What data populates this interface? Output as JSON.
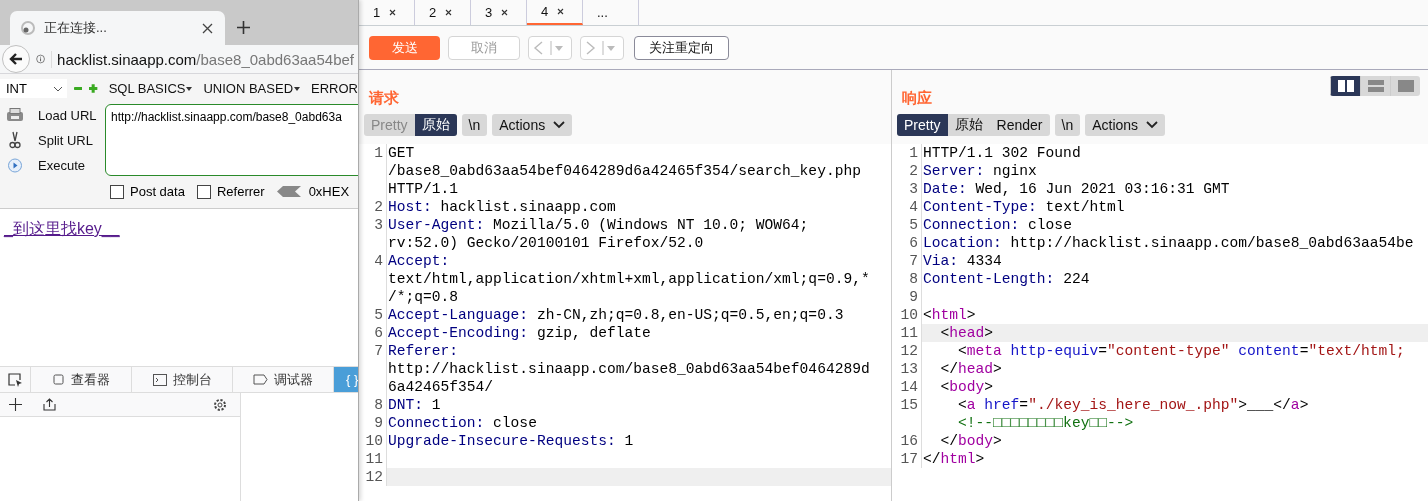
{
  "browser": {
    "tab": {
      "title": "正在连接..."
    },
    "address": {
      "host": "hacklist.sinaapp.com",
      "path": "/base8_0abd63aa54bef"
    },
    "hackbar": {
      "encoding": "INT",
      "menus": [
        {
          "label": "SQL BASICS",
          "dropdown": true
        },
        {
          "label": "UNION BASED",
          "dropdown": true
        },
        {
          "label": "ERROR",
          "dropdown": false
        }
      ],
      "actions": [
        {
          "label": "Load URL",
          "kind": "load"
        },
        {
          "label": "Split URL",
          "kind": "split"
        },
        {
          "label": "Execute",
          "kind": "execute"
        }
      ],
      "url": "http://hacklist.sinaapp.com/base8_0abd63a",
      "options": [
        {
          "label": "Post data",
          "checked": false
        },
        {
          "label": "Referrer",
          "checked": false
        }
      ],
      "encoder": "0xHEX"
    },
    "page_link": "_到这里找key__",
    "devtools": {
      "tabs": [
        {
          "label": "查看器",
          "kind": "inspector",
          "selected": false
        },
        {
          "label": "控制台",
          "kind": "console",
          "selected": false
        },
        {
          "label": "调试器",
          "kind": "debugger",
          "selected": false
        },
        {
          "label": "{ }",
          "kind": "style",
          "selected": true
        }
      ]
    }
  },
  "repeater": {
    "tabs": [
      {
        "label": "1",
        "closable": true,
        "selected": false
      },
      {
        "label": "2",
        "closable": true,
        "selected": false
      },
      {
        "label": "3",
        "closable": true,
        "selected": false
      },
      {
        "label": "4",
        "closable": true,
        "selected": true
      },
      {
        "label": "...",
        "closable": false,
        "selected": false
      }
    ],
    "send": {
      "label": "发送",
      "disabled": false
    },
    "cancel": {
      "label": "取消",
      "disabled": true
    },
    "back": {
      "disabled": true
    },
    "forward": {
      "disabled": true
    },
    "follow_redirect": {
      "label": "关注重定向",
      "disabled": false
    },
    "request": {
      "title": "请求",
      "views": [
        {
          "label": "Pretty",
          "selected": false,
          "disabled": true
        },
        {
          "label": "原始",
          "selected": true,
          "disabled": false
        }
      ],
      "newline": "\\n",
      "actions": "Actions",
      "lines": [
        {
          "number": "1",
          "highlighted": false,
          "rows": [
            [
              {
                "kind": "text",
                "text": "GET"
              }
            ],
            [
              {
                "kind": "text",
                "text": "/base8_0abd63aa54bef0464289d6a42465f354/search_key.php"
              }
            ],
            [
              {
                "kind": "text",
                "text": "HTTP/1.1"
              }
            ]
          ]
        },
        {
          "number": "2",
          "highlighted": false,
          "rows": [
            [
              {
                "kind": "key",
                "text": "Host:"
              },
              {
                "kind": "text",
                "text": " hacklist.sinaapp.com"
              }
            ]
          ]
        },
        {
          "number": "3",
          "highlighted": false,
          "rows": [
            [
              {
                "kind": "key",
                "text": "User-Agent:"
              },
              {
                "kind": "text",
                "text": " Mozilla/5.0 (Windows NT 10.0; WOW64;"
              }
            ],
            [
              {
                "kind": "text",
                "text": "rv:52.0) Gecko/20100101 Firefox/52.0"
              }
            ]
          ]
        },
        {
          "number": "4",
          "highlighted": false,
          "rows": [
            [
              {
                "kind": "key",
                "text": "Accept:"
              }
            ],
            [
              {
                "kind": "text",
                "text": "text/html,application/xhtml+xml,application/xml;q=0.9,*"
              }
            ],
            [
              {
                "kind": "text",
                "text": "/*;q=0.8"
              }
            ]
          ]
        },
        {
          "number": "5",
          "highlighted": false,
          "rows": [
            [
              {
                "kind": "key",
                "text": "Accept-Language:"
              },
              {
                "kind": "text",
                "text": " zh-CN,zh;q=0.8,en-US;q=0.5,en;q=0.3"
              }
            ]
          ]
        },
        {
          "number": "6",
          "highlighted": false,
          "rows": [
            [
              {
                "kind": "key",
                "text": "Accept-Encoding:"
              },
              {
                "kind": "text",
                "text": " gzip, deflate"
              }
            ]
          ]
        },
        {
          "number": "7",
          "highlighted": false,
          "rows": [
            [
              {
                "kind": "key",
                "text": "Referer:"
              }
            ],
            [
              {
                "kind": "text",
                "text": "http://hacklist.sinaapp.com/base8_0abd63aa54bef0464289d"
              }
            ],
            [
              {
                "kind": "text",
                "text": "6a42465f354/"
              }
            ]
          ]
        },
        {
          "number": "8",
          "highlighted": false,
          "rows": [
            [
              {
                "kind": "key",
                "text": "DNT:"
              },
              {
                "kind": "text",
                "text": " 1"
              }
            ]
          ]
        },
        {
          "number": "9",
          "highlighted": false,
          "rows": [
            [
              {
                "kind": "key",
                "text": "Connection:"
              },
              {
                "kind": "text",
                "text": " close"
              }
            ]
          ]
        },
        {
          "number": "10",
          "highlighted": false,
          "rows": [
            [
              {
                "kind": "key",
                "text": "Upgrade-Insecure-Requests:"
              },
              {
                "kind": "text",
                "text": " 1"
              }
            ]
          ]
        },
        {
          "number": "11",
          "highlighted": false
        },
        {
          "number": "12",
          "highlighted": true
        }
      ]
    },
    "response": {
      "title": "响应",
      "layouts": [
        {
          "kind": "split",
          "selected": true
        },
        {
          "kind": "stacked",
          "selected": false
        },
        {
          "kind": "single",
          "selected": false
        }
      ],
      "views": [
        {
          "label": "Pretty",
          "selected": true,
          "disabled": false
        },
        {
          "label": "原始",
          "selected": false,
          "disabled": false
        },
        {
          "label": "Render",
          "selected": false,
          "disabled": false
        }
      ],
      "newline": "\\n",
      "actions": "Actions",
      "lines": [
        {
          "number": "1",
          "highlighted": false,
          "rows": [
            [
              {
                "kind": "text",
                "text": "HTTP/1.1 302 Found"
              }
            ]
          ]
        },
        {
          "number": "2",
          "highlighted": false,
          "rows": [
            [
              {
                "kind": "key",
                "text": "Server:"
              },
              {
                "kind": "text",
                "text": " nginx"
              }
            ]
          ]
        },
        {
          "number": "3",
          "highlighted": false,
          "rows": [
            [
              {
                "kind": "key",
                "text": "Date:"
              },
              {
                "kind": "text",
                "text": " Wed, 16 Jun 2021 03:16:31 GMT"
              }
            ]
          ]
        },
        {
          "number": "4",
          "highlighted": false,
          "rows": [
            [
              {
                "kind": "key",
                "text": "Content-Type:"
              },
              {
                "kind": "text",
                "text": " text/html"
              }
            ]
          ]
        },
        {
          "number": "5",
          "highlighted": false,
          "rows": [
            [
              {
                "kind": "key",
                "text": "Connection:"
              },
              {
                "kind": "text",
                "text": " close"
              }
            ]
          ]
        },
        {
          "number": "6",
          "highlighted": false,
          "rows": [
            [
              {
                "kind": "key",
                "text": "Location:"
              },
              {
                "kind": "text",
                "text": " http://hacklist.sinaapp.com/base8_0abd63aa54be"
              }
            ]
          ]
        },
        {
          "number": "7",
          "highlighted": false,
          "rows": [
            [
              {
                "kind": "key",
                "text": "Via:"
              },
              {
                "kind": "text",
                "text": " 4334"
              }
            ]
          ]
        },
        {
          "number": "8",
          "highlighted": false,
          "rows": [
            [
              {
                "kind": "key",
                "text": "Content-Length:"
              },
              {
                "kind": "text",
                "text": " 224"
              }
            ]
          ]
        },
        {
          "number": "9",
          "highlighted": false
        },
        {
          "number": "10",
          "highlighted": false,
          "rows": [
            [
              {
                "kind": "text",
                "text": "<"
              },
              {
                "kind": "tag",
                "text": "html"
              },
              {
                "kind": "text",
                "text": ">"
              }
            ]
          ]
        },
        {
          "number": "11",
          "highlighted": true,
          "rows": [
            [
              {
                "kind": "text",
                "text": "  <"
              },
              {
                "kind": "tag",
                "text": "head"
              },
              {
                "kind": "text",
                "text": ">"
              }
            ]
          ]
        },
        {
          "number": "12",
          "highlighted": false,
          "rows": [
            [
              {
                "kind": "text",
                "text": "    <"
              },
              {
                "kind": "tag",
                "text": "meta"
              },
              {
                "kind": "text",
                "text": " "
              },
              {
                "kind": "attr",
                "text": "http-equiv"
              },
              {
                "kind": "text",
                "text": "="
              },
              {
                "kind": "string",
                "text": "\"content-type\""
              },
              {
                "kind": "text",
                "text": " "
              },
              {
                "kind": "attr",
                "text": "content"
              },
              {
                "kind": "text",
                "text": "="
              },
              {
                "kind": "string",
                "text": "\"text/html;"
              }
            ]
          ]
        },
        {
          "number": "13",
          "highlighted": false,
          "rows": [
            [
              {
                "kind": "text",
                "text": "  </"
              },
              {
                "kind": "tag",
                "text": "head"
              },
              {
                "kind": "text",
                "text": ">"
              }
            ]
          ]
        },
        {
          "number": "14",
          "highlighted": false,
          "rows": [
            [
              {
                "kind": "text",
                "text": "  <"
              },
              {
                "kind": "tag",
                "text": "body"
              },
              {
                "kind": "text",
                "text": ">"
              }
            ]
          ]
        },
        {
          "number": "15",
          "highlighted": false,
          "rows": [
            [
              {
                "kind": "text",
                "text": "    <"
              },
              {
                "kind": "tag",
                "text": "a"
              },
              {
                "kind": "text",
                "text": " "
              },
              {
                "kind": "attr",
                "text": "href"
              },
              {
                "kind": "text",
                "text": "="
              },
              {
                "kind": "string",
                "text": "\"./key_is_here_now_.php\""
              },
              {
                "kind": "text",
                "text": ">___</"
              },
              {
                "kind": "tag",
                "text": "a"
              },
              {
                "kind": "text",
                "text": ">"
              }
            ],
            [
              {
                "kind": "text",
                "text": "    "
              },
              {
                "kind": "comment",
                "text": "<!--□□□□□□□□key□□-->"
              }
            ]
          ]
        },
        {
          "number": "16",
          "highlighted": false,
          "rows": [
            [
              {
                "kind": "text",
                "text": "  </"
              },
              {
                "kind": "tag",
                "text": "body"
              },
              {
                "kind": "text",
                "text": ">"
              }
            ]
          ]
        },
        {
          "number": "17",
          "highlighted": false,
          "rows": [
            [
              {
                "kind": "text",
                "text": "</"
              },
              {
                "kind": "tag",
                "text": "html"
              },
              {
                "kind": "text",
                "text": ">"
              }
            ]
          ]
        }
      ]
    }
  }
}
